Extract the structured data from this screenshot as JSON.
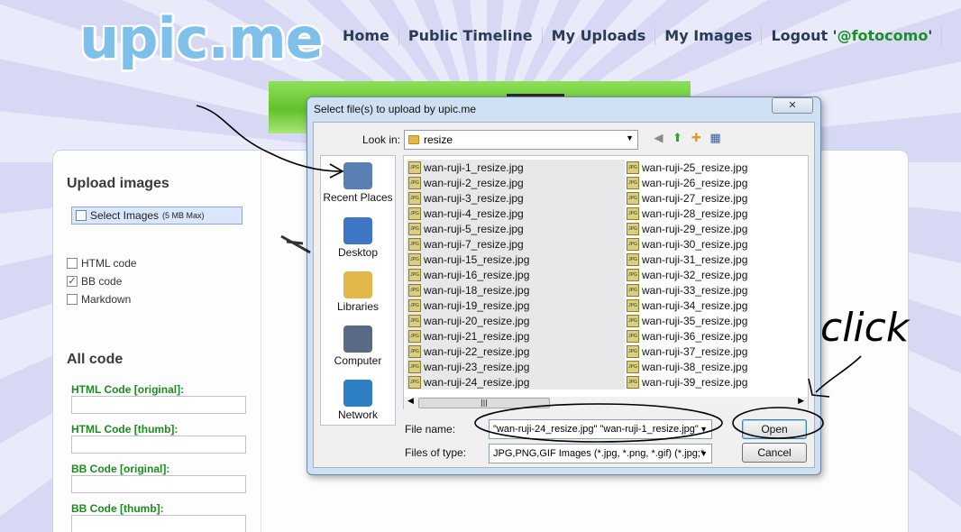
{
  "site": {
    "logo": "upic.me",
    "nav": [
      {
        "label": "Home"
      },
      {
        "label": "Public Timeline"
      },
      {
        "label": "My Uploads"
      },
      {
        "label": "My Images"
      }
    ],
    "logout_prefix": "Logout '",
    "logout_handle": "@fotocomo",
    "logout_suffix": "'"
  },
  "sidebar": {
    "upload_heading": "Upload images",
    "select_label": "Select Images",
    "select_max": "(5 MB Max)",
    "options": [
      {
        "label": "HTML code",
        "checked": false
      },
      {
        "label": "BB code",
        "checked": true
      },
      {
        "label": "Markdown",
        "checked": false
      }
    ],
    "all_code_heading": "All code",
    "code_fields": [
      {
        "label": "HTML Code [original]:"
      },
      {
        "label": "HTML Code [thumb]:"
      },
      {
        "label": "BB Code [original]:"
      },
      {
        "label": "BB Code [thumb]:"
      }
    ]
  },
  "dialog": {
    "title": "Select file(s) to upload by upic.me",
    "close": "✕",
    "look_in_label": "Look in:",
    "look_in_value": "resize",
    "places": [
      {
        "label": "Recent Places",
        "icon": "recent-places-icon",
        "color": "#5a7fb3"
      },
      {
        "label": "Desktop",
        "icon": "desktop-icon",
        "color": "#3f76c6"
      },
      {
        "label": "Libraries",
        "icon": "libraries-icon",
        "color": "#e2b84a"
      },
      {
        "label": "Computer",
        "icon": "computer-icon",
        "color": "#5a6a84"
      },
      {
        "label": "Network",
        "icon": "network-icon",
        "color": "#2f7fc4"
      }
    ],
    "files_left": [
      "wan-ruji-1_resize.jpg",
      "wan-ruji-2_resize.jpg",
      "wan-ruji-3_resize.jpg",
      "wan-ruji-4_resize.jpg",
      "wan-ruji-5_resize.jpg",
      "wan-ruji-7_resize.jpg",
      "wan-ruji-15_resize.jpg",
      "wan-ruji-16_resize.jpg",
      "wan-ruji-18_resize.jpg",
      "wan-ruji-19_resize.jpg",
      "wan-ruji-20_resize.jpg",
      "wan-ruji-21_resize.jpg",
      "wan-ruji-22_resize.jpg",
      "wan-ruji-23_resize.jpg",
      "wan-ruji-24_resize.jpg"
    ],
    "files_right": [
      "wan-ruji-25_resize.jpg",
      "wan-ruji-26_resize.jpg",
      "wan-ruji-27_resize.jpg",
      "wan-ruji-28_resize.jpg",
      "wan-ruji-29_resize.jpg",
      "wan-ruji-30_resize.jpg",
      "wan-ruji-31_resize.jpg",
      "wan-ruji-32_resize.jpg",
      "wan-ruji-33_resize.jpg",
      "wan-ruji-34_resize.jpg",
      "wan-ruji-35_resize.jpg",
      "wan-ruji-36_resize.jpg",
      "wan-ruji-37_resize.jpg",
      "wan-ruji-38_resize.jpg",
      "wan-ruji-39_resize.jpg"
    ],
    "file_name_label": "File name:",
    "file_name_value": "\"wan-ruji-24_resize.jpg\" \"wan-ruji-1_resize.jpg\"",
    "file_type_label": "Files of type:",
    "file_type_value": "JPG,PNG,GIF Images (*.jpg, *.png, *.gif) (*.jpg;*",
    "open_label": "Open",
    "cancel_label": "Cancel",
    "jpg_badge": "JPG"
  },
  "annotation": {
    "handwritten_text": "click"
  }
}
